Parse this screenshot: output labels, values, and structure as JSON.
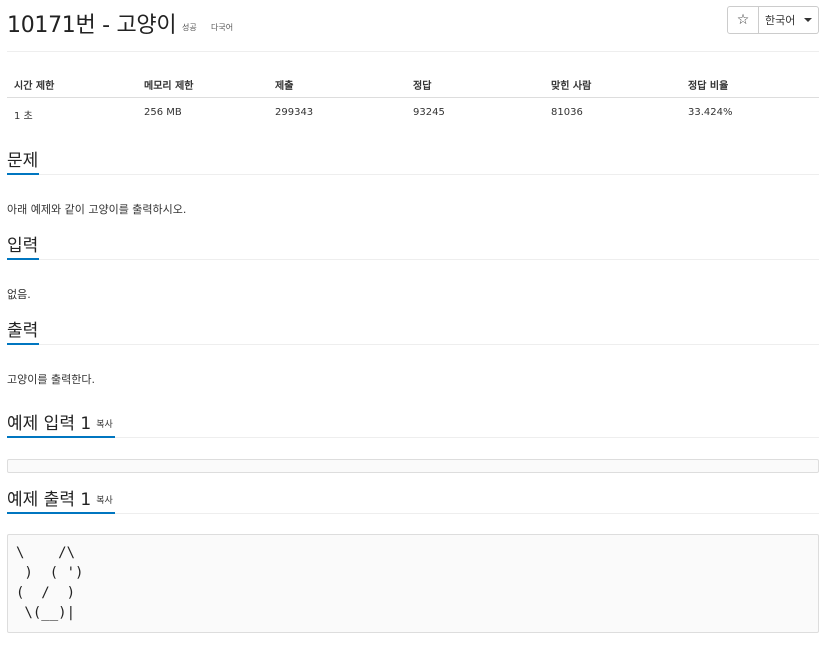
{
  "problem": {
    "title": "10171번 - 고양이",
    "badges": [
      "성공",
      "다국어"
    ],
    "language_label": "한국어",
    "star_icon": "star-outline-icon"
  },
  "info_table": {
    "headers": [
      "시간 제한",
      "메모리 제한",
      "제출",
      "정답",
      "맞힌 사람",
      "정답 비율"
    ],
    "values": [
      "1 초",
      "256 MB",
      "299343",
      "93245",
      "81036",
      "33.424%"
    ]
  },
  "sections": {
    "description": {
      "title": "문제",
      "text": "아래 예제와 같이 고양이를 출력하시오."
    },
    "input": {
      "title": "입력",
      "text": "없음."
    },
    "output": {
      "title": "출력",
      "text": "고양이를 출력한다."
    },
    "sample_input": {
      "title": "예제 입력 1",
      "copy_label": "복사",
      "content": ""
    },
    "sample_output": {
      "title": "예제 출력 1",
      "copy_label": "복사",
      "content": "\\    /\\\n )  ( ')\n(  /  )\n \\(__)|"
    }
  },
  "colors": {
    "accent": "#0076c0",
    "border": "#dddddd",
    "text": "#333333"
  }
}
